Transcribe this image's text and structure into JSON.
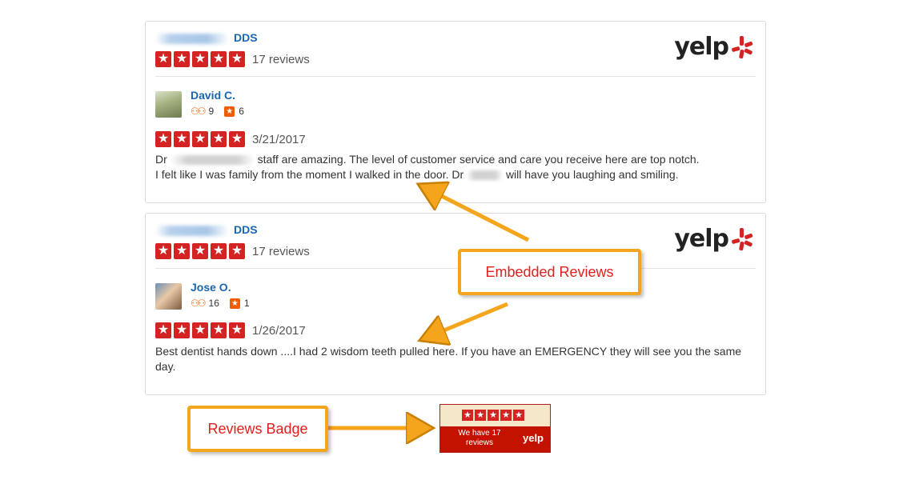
{
  "embedded_reviews": [
    {
      "business_suffix": "DDS",
      "business_rating_count": "17 reviews",
      "logo_text": "yelp",
      "reviewer": {
        "name": "David C.",
        "friends": "9",
        "reviews": "6"
      },
      "date": "3/21/2017",
      "text_1": "Dr",
      "text_2": "staff are amazing. The level of customer service and care you receive here are top notch.",
      "text_3": "I felt like I was family from the moment I walked in the door. Dr",
      "text_4": "will have you laughing and smiling."
    },
    {
      "business_suffix": "DDS",
      "business_rating_count": "17 reviews",
      "logo_text": "yelp",
      "reviewer": {
        "name": "Jose O.",
        "friends": "16",
        "reviews": "1"
      },
      "date": "1/26/2017",
      "text_1": "Best dentist hands down ....I had 2 wisdom teeth pulled here. If you have an EMERGENCY they will see you the same day."
    }
  ],
  "callouts": {
    "embedded": "Embedded Reviews",
    "badge": "Reviews Badge"
  },
  "badge": {
    "text": "We have 17 reviews",
    "logo_text": "yelp"
  },
  "colors": {
    "star_red": "#d32323",
    "link_blue": "#1a66b3",
    "callout_orange": "#f4a51c",
    "callout_text": "#e0201c",
    "yelp_red": "#c41200"
  }
}
